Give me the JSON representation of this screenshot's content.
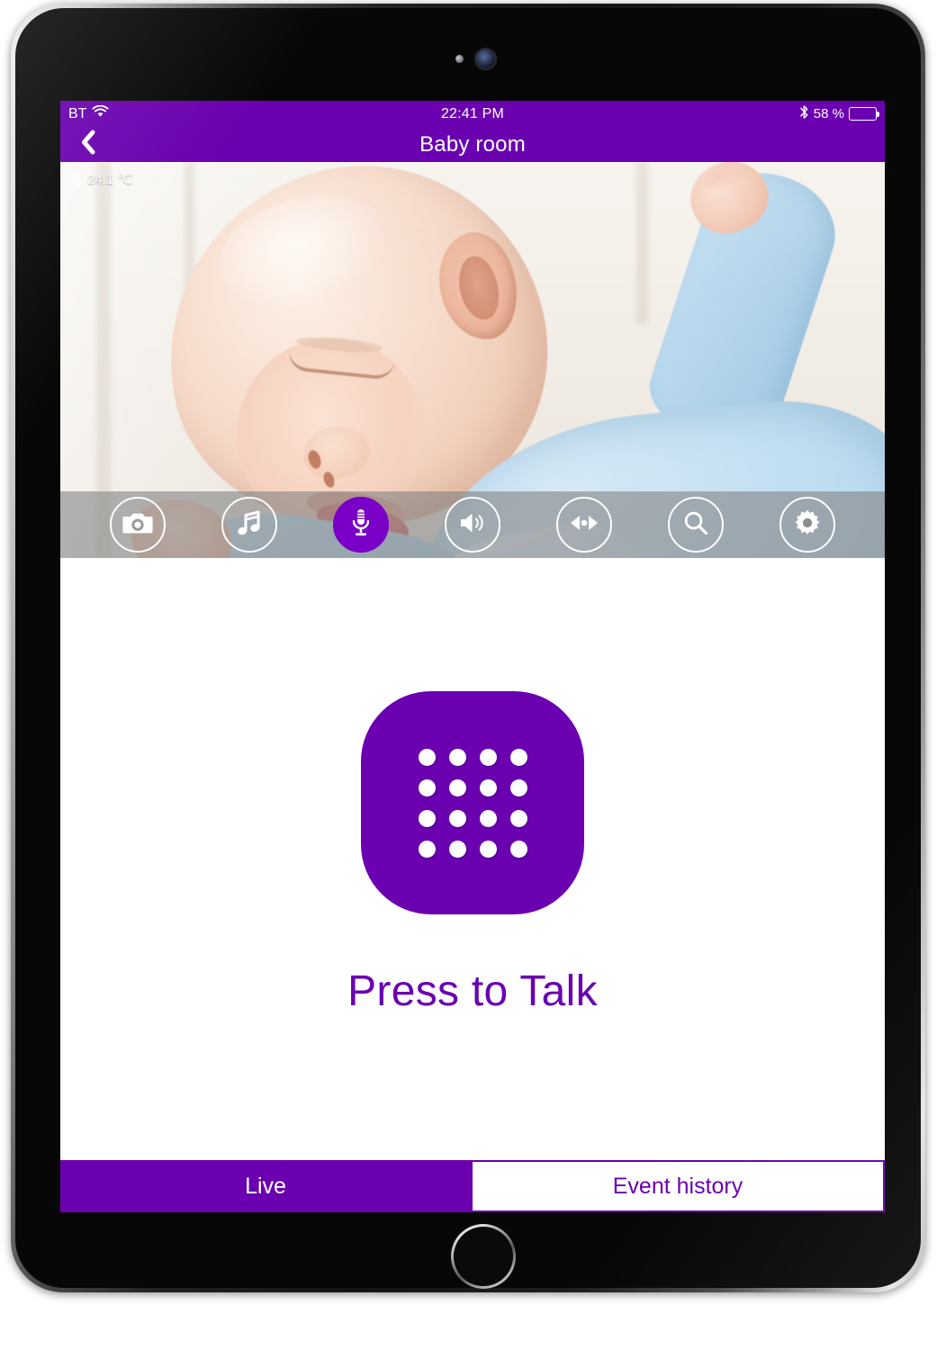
{
  "device": {
    "name": "tablet",
    "front_camera_icon": "front-camera-lens",
    "sensor_icon": "ambient-light-sensor",
    "home_button_icon": "home-button"
  },
  "status_bar": {
    "carrier": "BT",
    "wifi_icon": "wifi-icon",
    "time": "22:41 PM",
    "bluetooth_icon": "bluetooth-icon",
    "battery_percent": "58 %",
    "battery_level": 58
  },
  "nav_bar": {
    "back_icon": "back-chevron-icon",
    "title": "Baby room"
  },
  "video": {
    "temperature": "24.1 ℃",
    "thermometer_icon": "thermometer-icon",
    "scene_description": "sleeping baby in light blue sleepsuit"
  },
  "controls": [
    {
      "name": "snapshot",
      "icon": "camera-icon",
      "active": false
    },
    {
      "name": "lullaby",
      "icon": "music-note-icon",
      "active": false
    },
    {
      "name": "talk",
      "icon": "microphone-icon",
      "active": true
    },
    {
      "name": "volume",
      "icon": "speaker-icon",
      "active": false
    },
    {
      "name": "pan-tilt",
      "icon": "pan-arrows-icon",
      "active": false
    },
    {
      "name": "zoom",
      "icon": "magnifier-icon",
      "active": false
    },
    {
      "name": "settings",
      "icon": "gear-icon",
      "active": false
    }
  ],
  "talk": {
    "button_icon": "mic-grille-icon",
    "grid_rows": 4,
    "grid_cols": 4,
    "label": "Press to Talk"
  },
  "tabs": [
    {
      "label": "Live",
      "active": true
    },
    {
      "label": "Event history",
      "active": false
    }
  ],
  "colors": {
    "brand_purple": "#6a00b0",
    "accent_purple": "#7a00c8",
    "toolbar_overlay": "rgba(128,128,128,.58)",
    "white": "#ffffff"
  }
}
